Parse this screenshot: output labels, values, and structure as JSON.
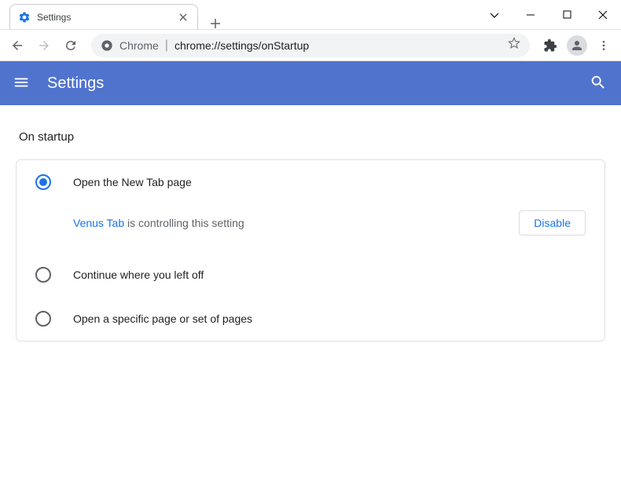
{
  "tab": {
    "title": "Settings"
  },
  "omnibox": {
    "prefix": "Chrome",
    "url": "chrome://settings/onStartup"
  },
  "header": {
    "title": "Settings"
  },
  "section": {
    "title": "On startup"
  },
  "options": [
    {
      "label": "Open the New Tab page",
      "selected": true
    },
    {
      "label": "Continue where you left off",
      "selected": false
    },
    {
      "label": "Open a specific page or set of pages",
      "selected": false
    }
  ],
  "notice": {
    "extension_name": "Venus Tab",
    "message": "is controlling this setting",
    "button": "Disable"
  }
}
